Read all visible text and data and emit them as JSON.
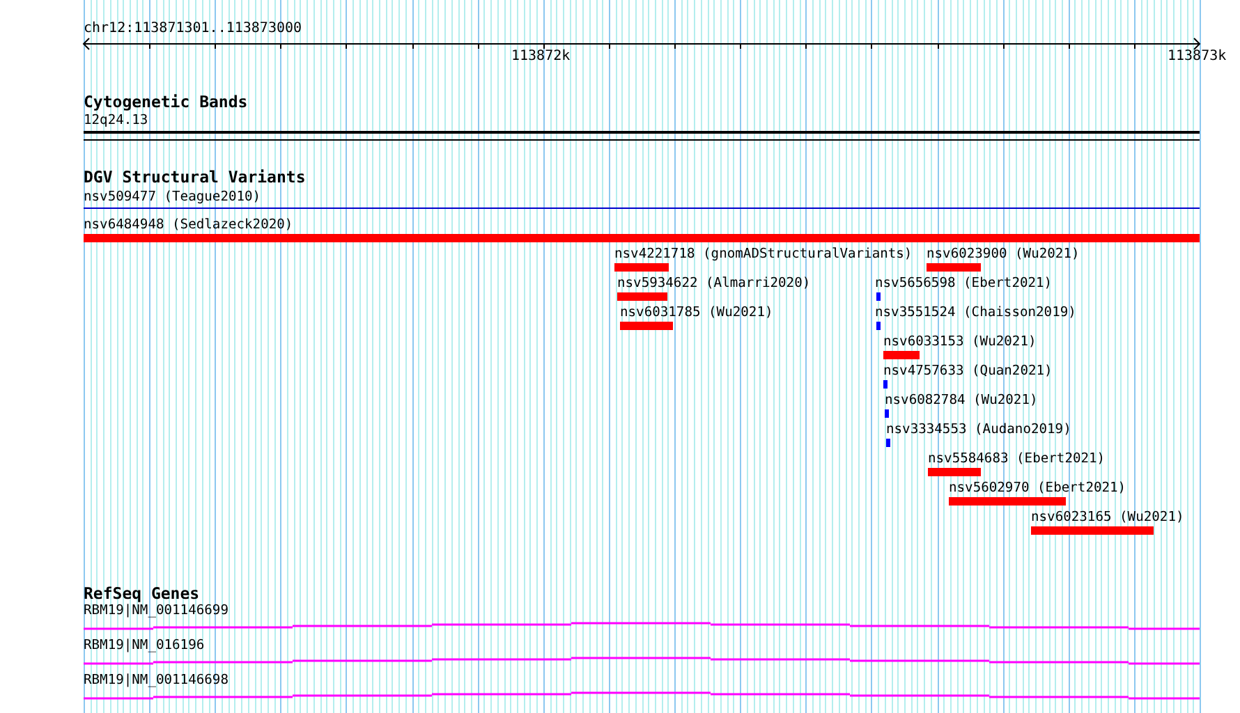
{
  "location": "chr12:113871301..113873000",
  "ruler": {
    "ticks": [
      "113872k",
      "113873k"
    ]
  },
  "tracks": [
    {
      "kind": "bands",
      "title": "Cytogenetic Bands",
      "features": [
        {
          "label": "12q24.13"
        }
      ]
    },
    {
      "kind": "variants",
      "title": "DGV Structural Variants",
      "features": [
        {
          "label": "nsv509477 (Teague2010)",
          "color": "#0000cc"
        },
        {
          "label": "nsv6484948 (Sedlazeck2020)",
          "color": "#ff0000"
        },
        {
          "label": "nsv4221718 (gnomADStructuralVariants)",
          "color": "#ff0000"
        },
        {
          "label": "nsv6023900 (Wu2021)",
          "color": "#ff0000"
        },
        {
          "label": "nsv5934622 (Almarri2020)",
          "color": "#ff0000"
        },
        {
          "label": "nsv5656598 (Ebert2021)",
          "color": "#0000ff"
        },
        {
          "label": "nsv6031785 (Wu2021)",
          "color": "#ff0000"
        },
        {
          "label": "nsv3551524 (Chaisson2019)",
          "color": "#0000ff"
        },
        {
          "label": "nsv6033153 (Wu2021)",
          "color": "#ff0000"
        },
        {
          "label": "nsv4757633 (Quan2021)",
          "color": "#0000ff"
        },
        {
          "label": "nsv6082784 (Wu2021)",
          "color": "#0000ff"
        },
        {
          "label": "nsv3334553 (Audano2019)",
          "color": "#0000ff"
        },
        {
          "label": "nsv5584683 (Ebert2021)",
          "color": "#ff0000"
        },
        {
          "label": "nsv5602970 (Ebert2021)",
          "color": "#ff0000"
        },
        {
          "label": "nsv6023165 (Wu2021)",
          "color": "#ff0000"
        }
      ]
    },
    {
      "kind": "genes",
      "title": "RefSeq Genes",
      "features": [
        {
          "label": "RBM19|NM_001146699"
        },
        {
          "label": "RBM19|NM_016196"
        },
        {
          "label": "RBM19|NM_001146698"
        }
      ]
    }
  ]
}
